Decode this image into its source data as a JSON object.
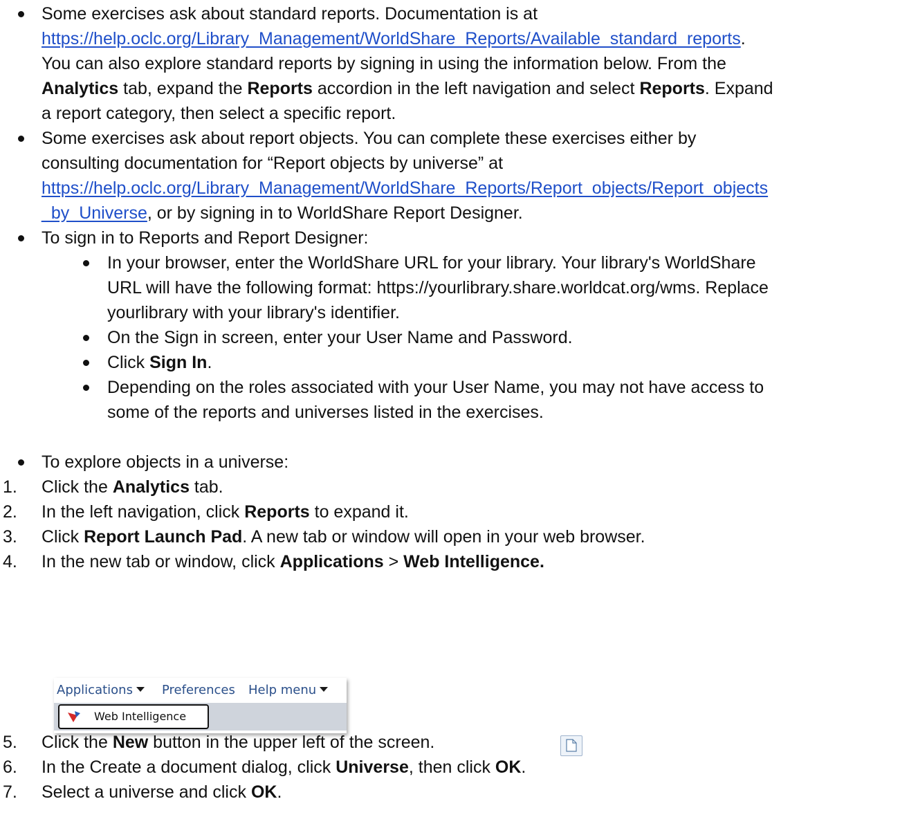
{
  "bullets": [
    {
      "lines": [
        [
          "Some exercises ask about standard reports. Documentation is at"
        ],
        [
          {
            "link": "https://help.oclc.org/Library_Management/WorldShare_Reports/Available_standard_reports"
          },
          "."
        ],
        [
          "You can also explore standard reports by signing in using the information below.  From the"
        ],
        [
          {
            "b": "Analytics"
          },
          " tab, expand the ",
          {
            "b": "Reports"
          },
          " accordion in the left navigation and select ",
          {
            "b": "Reports"
          },
          ". Expand"
        ],
        [
          "a report category, then select a specific report."
        ]
      ]
    },
    {
      "lines": [
        [
          "Some exercises ask about report objects. You can complete these exercises either by"
        ],
        [
          "consulting documentation for “Report objects by universe” at"
        ],
        [
          {
            "link": "https://help.oclc.org/Library_Management/WorldShare_Reports/Report_objects/Report_objects"
          }
        ],
        [
          {
            "link": "_by_Universe"
          },
          ", or by signing in to WorldShare Report Designer."
        ]
      ]
    },
    {
      "lines": [
        [
          "To sign in to Reports and Report Designer:"
        ]
      ]
    }
  ],
  "sub_bullets": [
    {
      "lines": [
        [
          "In your browser, enter the WorldShare URL for your library. Your library's WorldShare"
        ],
        [
          "URL will have the following format: https://yourlibrary.share.worldcat.org/wms. Replace"
        ],
        [
          "yourlibrary with your library's identifier."
        ]
      ]
    },
    {
      "lines": [
        [
          "On the Sign in screen, enter your User Name and Password."
        ]
      ]
    },
    {
      "lines": [
        [
          "Click ",
          {
            "b": "Sign In"
          },
          "."
        ]
      ]
    },
    {
      "lines": [
        [
          "Depending on the roles associated with your User Name, you may not have access to"
        ],
        [
          "some of the reports and universes listed in the exercises."
        ]
      ]
    }
  ],
  "explore_bullet": "To explore objects in a universe:",
  "steps": [
    {
      "num": "1.",
      "parts": [
        "Click the ",
        {
          "b": "Analytics"
        },
        " tab."
      ]
    },
    {
      "num": "2.",
      "parts": [
        "In the left navigation, click ",
        {
          "b": "Reports"
        },
        " to expand it."
      ]
    },
    {
      "num": "3.",
      "parts": [
        "Click ",
        {
          "b": "Report Launch Pad"
        },
        ". A new tab or window will open in your web browser."
      ]
    },
    {
      "num": "4.",
      "parts": [
        "In the new tab or window, click ",
        {
          "b": "Applications"
        },
        " > ",
        {
          "b": "Web Intelligence."
        }
      ]
    },
    {
      "num": "5.",
      "parts": [
        "Click the ",
        {
          "b": "New"
        },
        " button in the upper left of the screen."
      ]
    },
    {
      "num": "6.",
      "parts": [
        "In the Create a document dialog, click ",
        {
          "b": "Universe"
        },
        ", then click ",
        {
          "b": "OK"
        },
        "."
      ]
    },
    {
      "num": "7.",
      "parts": [
        "Select a universe and click ",
        {
          "b": "OK"
        },
        "."
      ]
    }
  ],
  "menu_screenshot": {
    "menu_applications": "Applications",
    "menu_preferences": "Preferences",
    "menu_help": "Help menu",
    "item_web_intelligence": "Web Intelligence",
    "link_color": "#2a4f8a"
  },
  "new_button_icon": "new-document-icon",
  "colors": {
    "link": "#1f4fc9",
    "text": "#111111"
  }
}
